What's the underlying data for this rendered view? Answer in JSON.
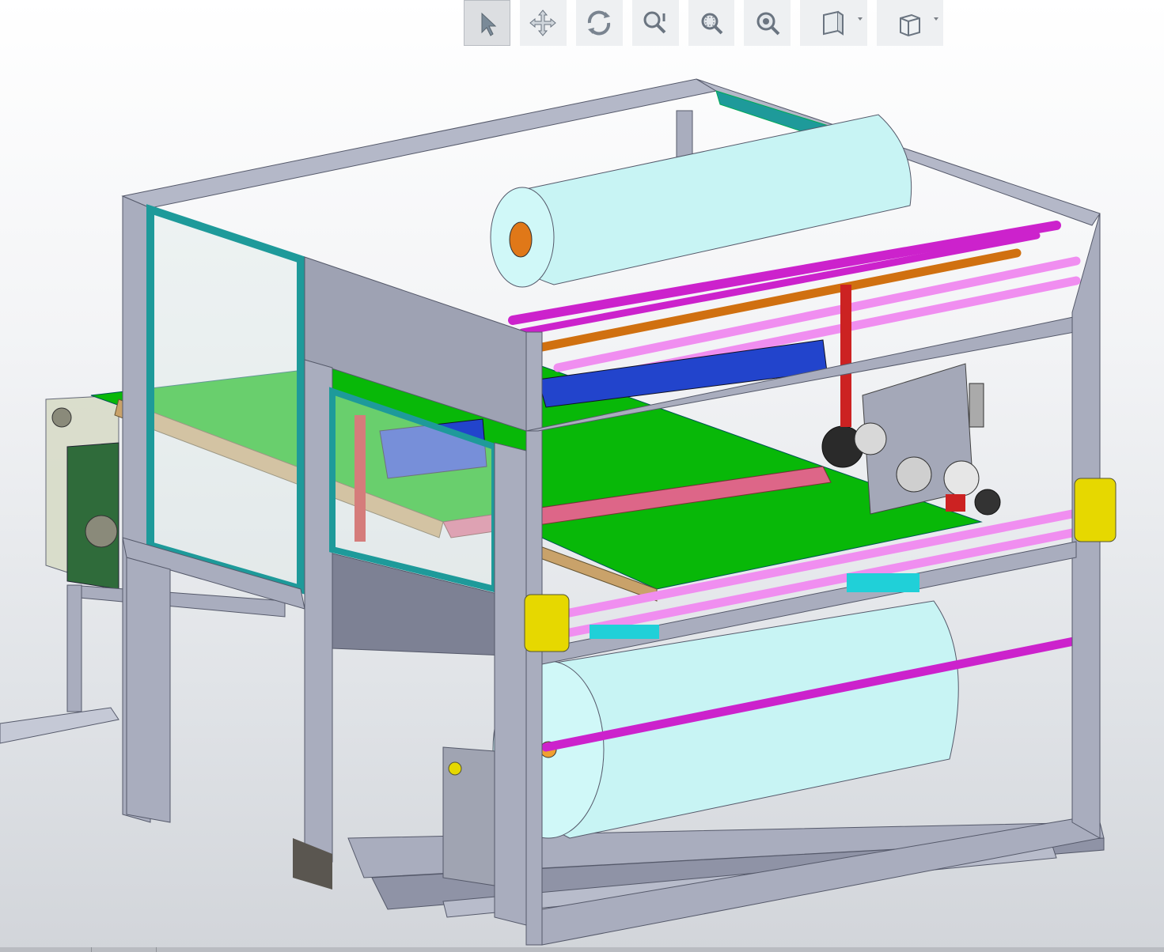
{
  "toolbar": {
    "buttons": [
      {
        "icon": "select-arrow-icon",
        "active": true
      },
      {
        "icon": "pan-move-icon",
        "active": false
      },
      {
        "icon": "rotate-view-icon",
        "active": false
      },
      {
        "icon": "zoom-dynamic-icon",
        "active": false
      },
      {
        "icon": "zoom-window-icon",
        "active": false
      },
      {
        "icon": "zoom-fit-icon",
        "active": false
      },
      {
        "icon": "section-view-icon",
        "active": false,
        "dropdown": true
      },
      {
        "icon": "view-orientation-cube-icon",
        "active": false,
        "dropdown": true
      }
    ]
  },
  "model": {
    "colors": {
      "frame": "#a9adbe",
      "frame_dark": "#7d8194",
      "glass_trim": "#1e9a9a",
      "glass": "#dfeae8",
      "film_roll": "#c8f4f4",
      "roller_magenta": "#cc22cc",
      "roller_pink": "#f08ef0",
      "roller_orange": "#d07010",
      "belt": "#08b808",
      "bracket_yellow": "#e6d800",
      "board_brown": "#c9a26a",
      "plate_blue": "#2244cc",
      "plate_red": "#cc2222",
      "cyan_block": "#20d0d8"
    }
  }
}
